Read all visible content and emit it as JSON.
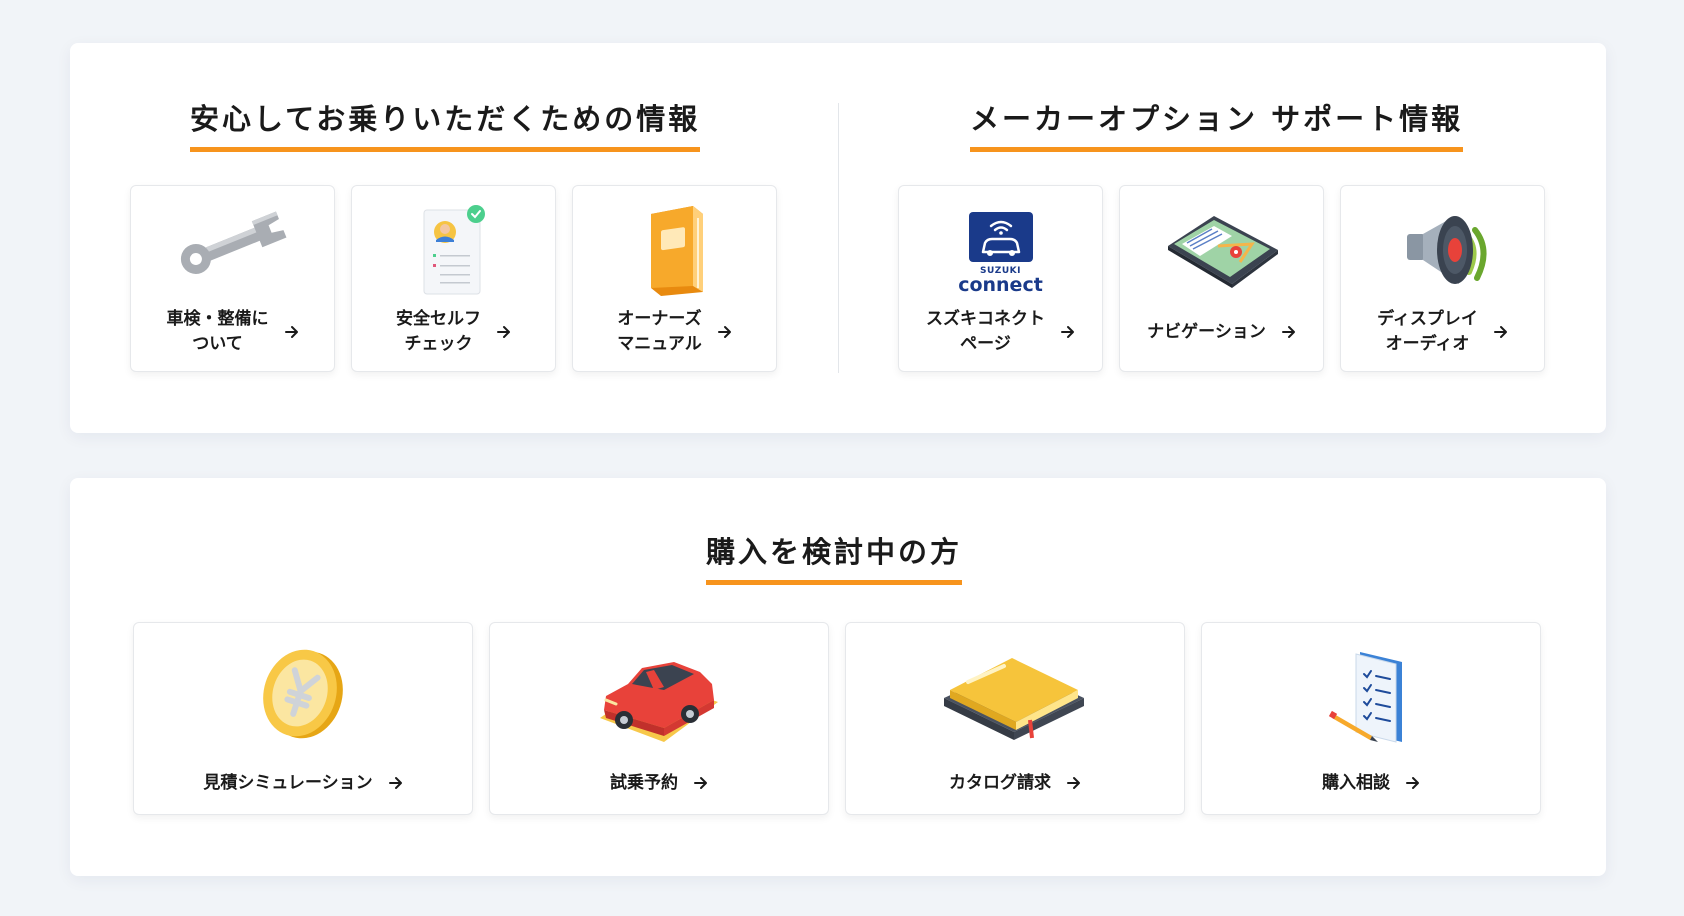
{
  "sections": {
    "safety": {
      "title": "安心してお乗りいただくための情報",
      "items": [
        {
          "label": "車検・整備に\nついて",
          "icon": "wrench-icon"
        },
        {
          "label": "安全セルフ\nチェック",
          "icon": "checklist-icon"
        },
        {
          "label": "オーナーズ\nマニュアル",
          "icon": "manual-book-icon"
        }
      ]
    },
    "maker_option": {
      "title": "メーカーオプション サポート情報",
      "items": [
        {
          "label": "スズキコネクト\nページ",
          "icon": "suzuki-connect-logo",
          "logo_text_top": "SUZUKI",
          "logo_text_bottom": "connect"
        },
        {
          "label": "ナビゲーション",
          "icon": "navigation-tablet-icon"
        },
        {
          "label": "ディスプレイ\nオーディオ",
          "icon": "speaker-icon"
        }
      ]
    },
    "purchase": {
      "title": "購入を検討中の方",
      "items": [
        {
          "label": "見積シミュレーション",
          "icon": "yen-coin-icon"
        },
        {
          "label": "試乗予約",
          "icon": "red-car-icon"
        },
        {
          "label": "カタログ請求",
          "icon": "catalog-book-icon"
        },
        {
          "label": "購入相談",
          "icon": "notepad-pencil-icon"
        }
      ]
    }
  },
  "colors": {
    "accent": "#f7941d",
    "suzuki_blue": "#1a3a8a",
    "page_background": "#f1f4f8"
  }
}
